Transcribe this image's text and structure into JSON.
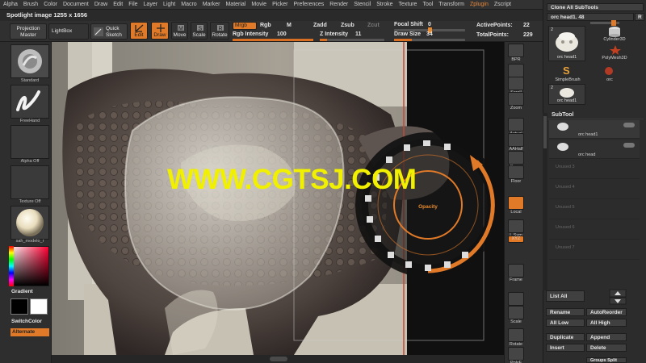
{
  "menu": [
    "Alpha",
    "Brush",
    "Color",
    "Document",
    "Draw",
    "Edit",
    "File",
    "Layer",
    "Light",
    "Macro",
    "Marker",
    "Material",
    "Movie",
    "Picker",
    "Preferences",
    "Render",
    "Stencil",
    "Stroke",
    "Texture",
    "Tool",
    "Transform",
    "Zplugin",
    "Zscript"
  ],
  "menu_highlight_index": 21,
  "info": {
    "spotlight": "Spotlight image 1255 x 1656"
  },
  "toolbar": {
    "projection_master": "Projection Master",
    "lightbox": "LightBox",
    "quick_sketch": "Quick Sketch",
    "edit": "Edit",
    "draw": "Draw",
    "move": "Move",
    "scale": "Scale",
    "rotate": "Rotate",
    "mrgb": "Mrgb",
    "rgb": "Rgb",
    "m": "M",
    "rgb_intensity_label": "Rgb Intensity",
    "rgb_intensity": "100",
    "zadd": "Zadd",
    "zsub": "Zsub",
    "zcut": "Zcut",
    "z_intensity_label": "Z Intensity",
    "z_intensity": "11",
    "focal_shift_label": "Focal Shift",
    "focal_shift": "0",
    "draw_size_label": "Draw Size",
    "draw_size": "34",
    "active_points_label": "ActivePoints:",
    "active_points": "22",
    "total_points_label": "TotalPoints:",
    "total_points": "229"
  },
  "left_panel": {
    "standard": "Standard",
    "freehand": "FreeHand",
    "alpha_off": "Alpha Off",
    "texture_off": "Texture Off",
    "material": "sah_modelo_r",
    "gradient": "Gradient",
    "switch_color": "SwitchColor",
    "alternate": "Alternate"
  },
  "canvas": {
    "opacity_label": "Opacity",
    "watermark": "WWW.CGTSJ.COM"
  },
  "shelf": [
    "BPR",
    "SPix",
    "Scroll",
    "Zoom",
    "Actual",
    "AAHalf",
    "Persp",
    "Floor",
    "Local",
    "L.Sym",
    "XYZ",
    "Frame",
    "Move",
    "Scale",
    "Rotate",
    "PolyF"
  ],
  "right_panel": {
    "clone_all": "Clone All SubTools",
    "tool_name": "orc head1. 48",
    "r_button": "R",
    "tool_thumb_label": "orc head1",
    "cylinder": "Cylinder3D",
    "polymesh": "PolyMesh3D",
    "simplebrush": "SimpleBrush",
    "orc": "orc",
    "tool_thumb2_label": "orc head1",
    "tool_badge1": "2",
    "tool_badge2": "2",
    "subtool_header": "SubTool",
    "subtool_items": [
      "orc head1",
      "orc head",
      "Unused 3",
      "Unused 4",
      "Unused 5",
      "Unused 6",
      "Unused 7"
    ],
    "list_all": "List All",
    "rename": "Rename",
    "auto_reorder": "AutoReorder",
    "all_low": "All Low",
    "all_high": "All High",
    "duplicate": "Duplicate",
    "append": "Append",
    "insert": "Insert",
    "delete": "Delete",
    "groups_split": "Groups Split"
  },
  "colors": {
    "accent": "#e07a28",
    "watermark": "#f0f000",
    "panel": "#2c2c2c"
  }
}
